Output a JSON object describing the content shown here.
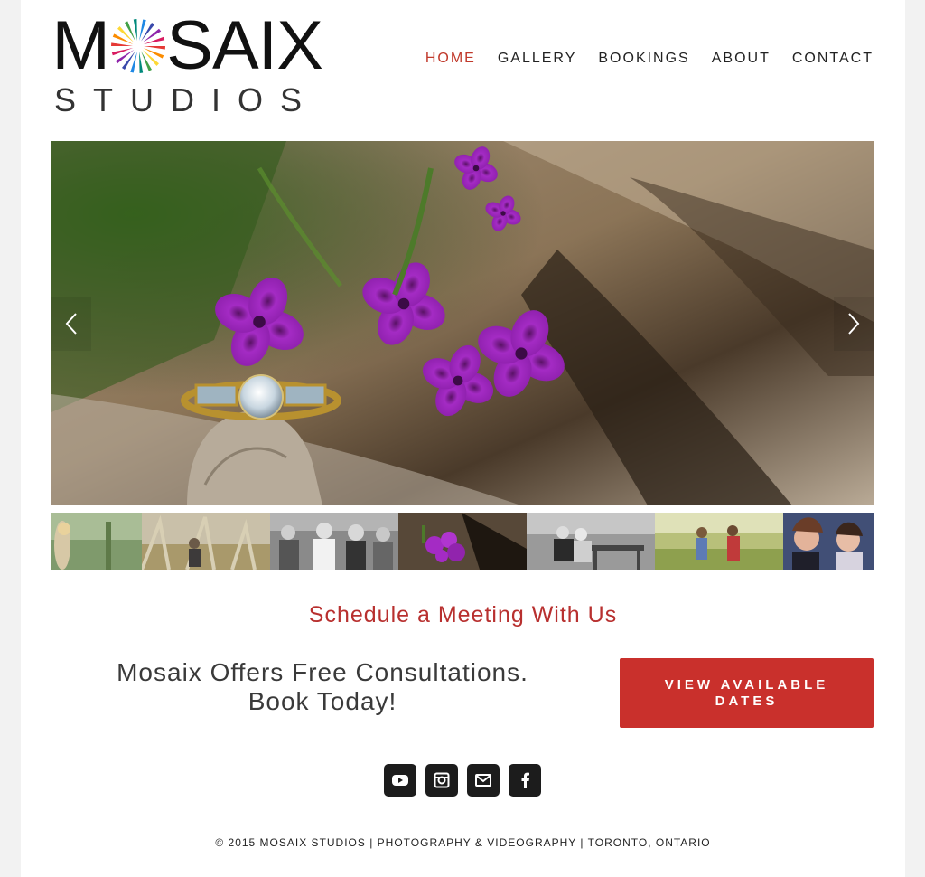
{
  "header": {
    "logo_main_left": "M",
    "logo_main_right": "SAIX",
    "logo_sub": "STUDIOS",
    "nav": [
      {
        "label": "HOME",
        "active": true
      },
      {
        "label": "GALLERY",
        "active": false
      },
      {
        "label": "BOOKINGS",
        "active": false
      },
      {
        "label": "ABOUT",
        "active": false
      },
      {
        "label": "CONTACT",
        "active": false
      }
    ]
  },
  "slider": {
    "prev_icon": "chevron-left-icon",
    "next_icon": "chevron-right-icon",
    "thumbnails": [
      {
        "name": "thumb-woman-forest",
        "active": false
      },
      {
        "name": "thumb-couple-grass",
        "active": false
      },
      {
        "name": "thumb-group-bw",
        "active": false
      },
      {
        "name": "thumb-ring-flowers",
        "active": true
      },
      {
        "name": "thumb-couple-bench-bw",
        "active": false
      },
      {
        "name": "thumb-couple-field",
        "active": false
      },
      {
        "name": "thumb-friends-laughing",
        "active": false
      }
    ]
  },
  "schedule": {
    "title": "Schedule a Meeting With Us",
    "text_line1": "Mosaix Offers Free Consultations.",
    "text_line2": "Book Today!",
    "cta_label": "VIEW AVAILABLE DATES"
  },
  "social": [
    "youtube-icon",
    "instagram-icon",
    "email-icon",
    "facebook-icon"
  ],
  "footer": {
    "text": "© 2015 MOSAIX STUDIOS | PHOTOGRAPHY & VIDEOGRAPHY | TORONTO, ONTARIO"
  },
  "colors": {
    "accent": "#c9302c",
    "nav_active": "#c0392b",
    "text_dark": "#222222"
  }
}
